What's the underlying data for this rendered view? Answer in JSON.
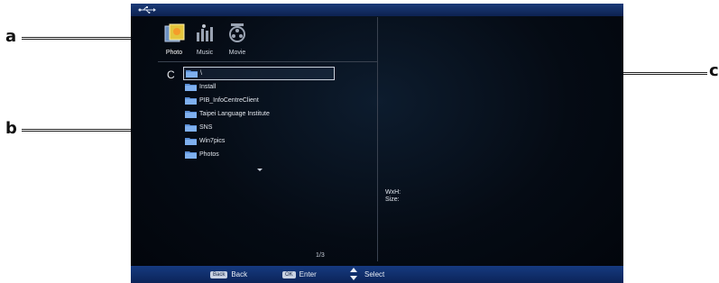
{
  "callouts": {
    "a": "a",
    "b": "b",
    "c": "c"
  },
  "media_tabs": [
    {
      "label": "Photo",
      "icon": "photo-icon"
    },
    {
      "label": "Music",
      "icon": "music-icon"
    },
    {
      "label": "Movie",
      "icon": "movie-icon"
    }
  ],
  "browser": {
    "drive": "C",
    "items": [
      {
        "name": "\\",
        "selected": true
      },
      {
        "name": "Install"
      },
      {
        "name": "PIB_InfoCentreClient"
      },
      {
        "name": "Taipei Language Institute"
      },
      {
        "name": "SNS"
      },
      {
        "name": "Win7pics"
      },
      {
        "name": "Photos"
      }
    ],
    "page_indicator": "1/3"
  },
  "info": {
    "dimensions_label": "WxH:",
    "size_label": "Size:"
  },
  "footer": {
    "back_key": "Back",
    "back_label": "Back",
    "ok_key": "OK",
    "ok_label": "Enter",
    "select_label": "Select"
  },
  "colors": {
    "bar_blue": "#163a80",
    "screen_bg": "#050b14",
    "folder": "#5b8fd6"
  }
}
